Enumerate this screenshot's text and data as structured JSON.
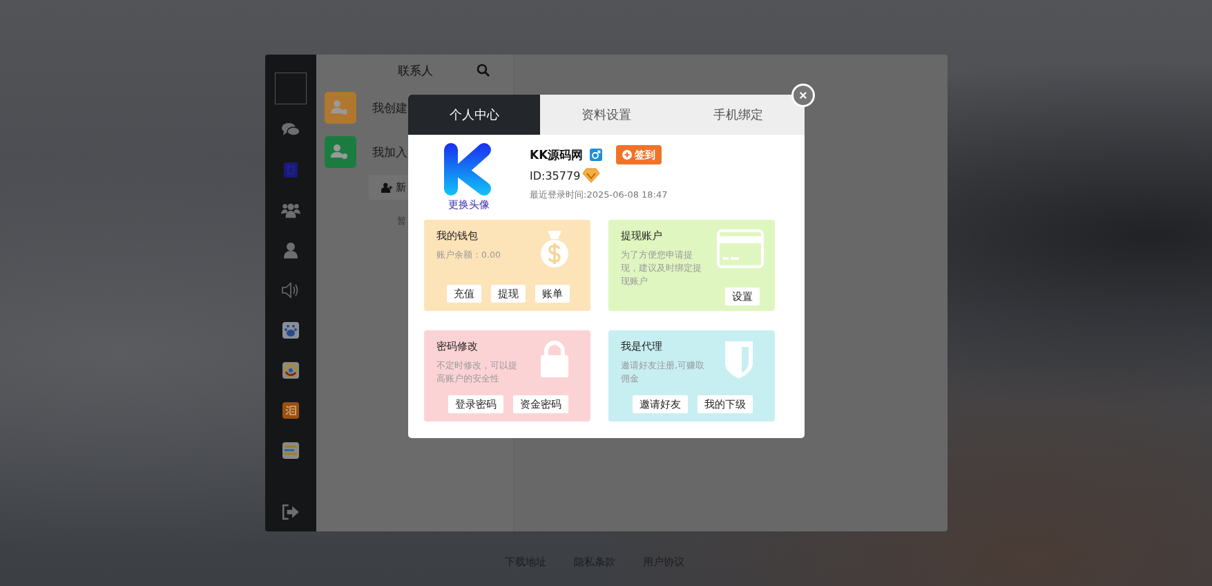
{
  "contacts": {
    "title": "联系人",
    "groups": [
      {
        "label": "我创建",
        "color": "#b0772f"
      },
      {
        "label": "我加入",
        "color": "#1a7d3f"
      }
    ],
    "new_button": "新",
    "empty_text": "暂"
  },
  "modal": {
    "tabs": [
      {
        "label": "个人中心",
        "selected": true
      },
      {
        "label": "资料设置",
        "selected": false
      },
      {
        "label": "手机绑定",
        "selected": false
      }
    ],
    "avatar_link": "更换头像",
    "username": "KK源码网",
    "checkin_button": "签到",
    "user_id": "ID:35779",
    "last_login": "最近登录时间:2025-06-08 18:47",
    "cards": [
      {
        "kind": "wallet",
        "title": "我的钱包",
        "description": "账户余额：0.00",
        "color": "#fde3b8",
        "buttons": [
          "充值",
          "提现",
          "账单"
        ]
      },
      {
        "kind": "account",
        "title": "提现账户",
        "description": "为了方便您申请提现，建议及时绑定提现账户",
        "color": "#e0f6c0",
        "buttons": [
          "设置"
        ]
      },
      {
        "kind": "password",
        "title": "密码修改",
        "description": "不定时修改，可以提高账户的安全性",
        "color": "#fcd3d5",
        "buttons": [
          "登录密码",
          "资金密码"
        ]
      },
      {
        "kind": "agent",
        "title": "我是代理",
        "description": "邀请好友注册,可赚取佣金",
        "color": "#c7eff2",
        "buttons": [
          "邀请好友",
          "我的下级"
        ]
      }
    ]
  },
  "footer": {
    "links": [
      "下载地址",
      "隐私条款",
      "用户协议"
    ]
  }
}
